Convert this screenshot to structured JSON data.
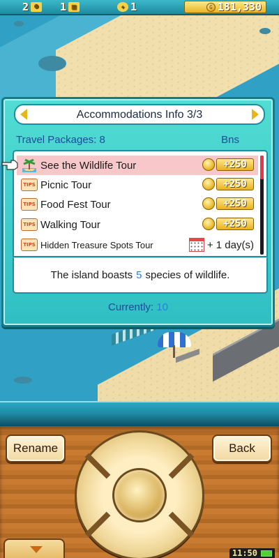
{
  "status_bar": {
    "stat_one_value": "2",
    "stat_one_icon": "people-icon",
    "stat_two_value": "1",
    "stat_two_icon": "building-icon",
    "stat_three_value": "1",
    "stat_three_icon": "lightbulb-icon",
    "money": "181,330"
  },
  "dialog": {
    "title": "Accommodations Info 3/3",
    "packages_label": "Travel Packages: 8",
    "bonus_header": "Bns",
    "packages": [
      {
        "name": "See the Wildlife Tour",
        "icon": "wildlife-tour-icon",
        "bonus": "+250",
        "selected": true
      },
      {
        "name": "Picnic Tour",
        "icon": "tips-icon",
        "bonus": "+250",
        "selected": false
      },
      {
        "name": "Food Fest Tour",
        "icon": "tips-icon",
        "bonus": "+250",
        "selected": false
      },
      {
        "name": "Walking Tour",
        "icon": "tips-icon",
        "bonus": "+250",
        "selected": false
      },
      {
        "name": "Hidden Treasure Spots Tour",
        "icon": "tips-icon",
        "bonus": "+ 1 day(s)",
        "selected": false
      }
    ],
    "description": {
      "before": "The island boasts",
      "number": "5",
      "after": "species of wildlife."
    },
    "currently_label": "Currently:",
    "currently_value": "10"
  },
  "controls": {
    "rename_label": "Rename",
    "back_label": "Back"
  },
  "system": {
    "time": "11:50"
  },
  "colors": {
    "dialog_bg": "#52dcd3",
    "selected_row": "#f8c7c9",
    "label_blue": "#1a4c9a",
    "highlight_number": "#2b7fd6",
    "coin_gold": "#e8b21f"
  }
}
